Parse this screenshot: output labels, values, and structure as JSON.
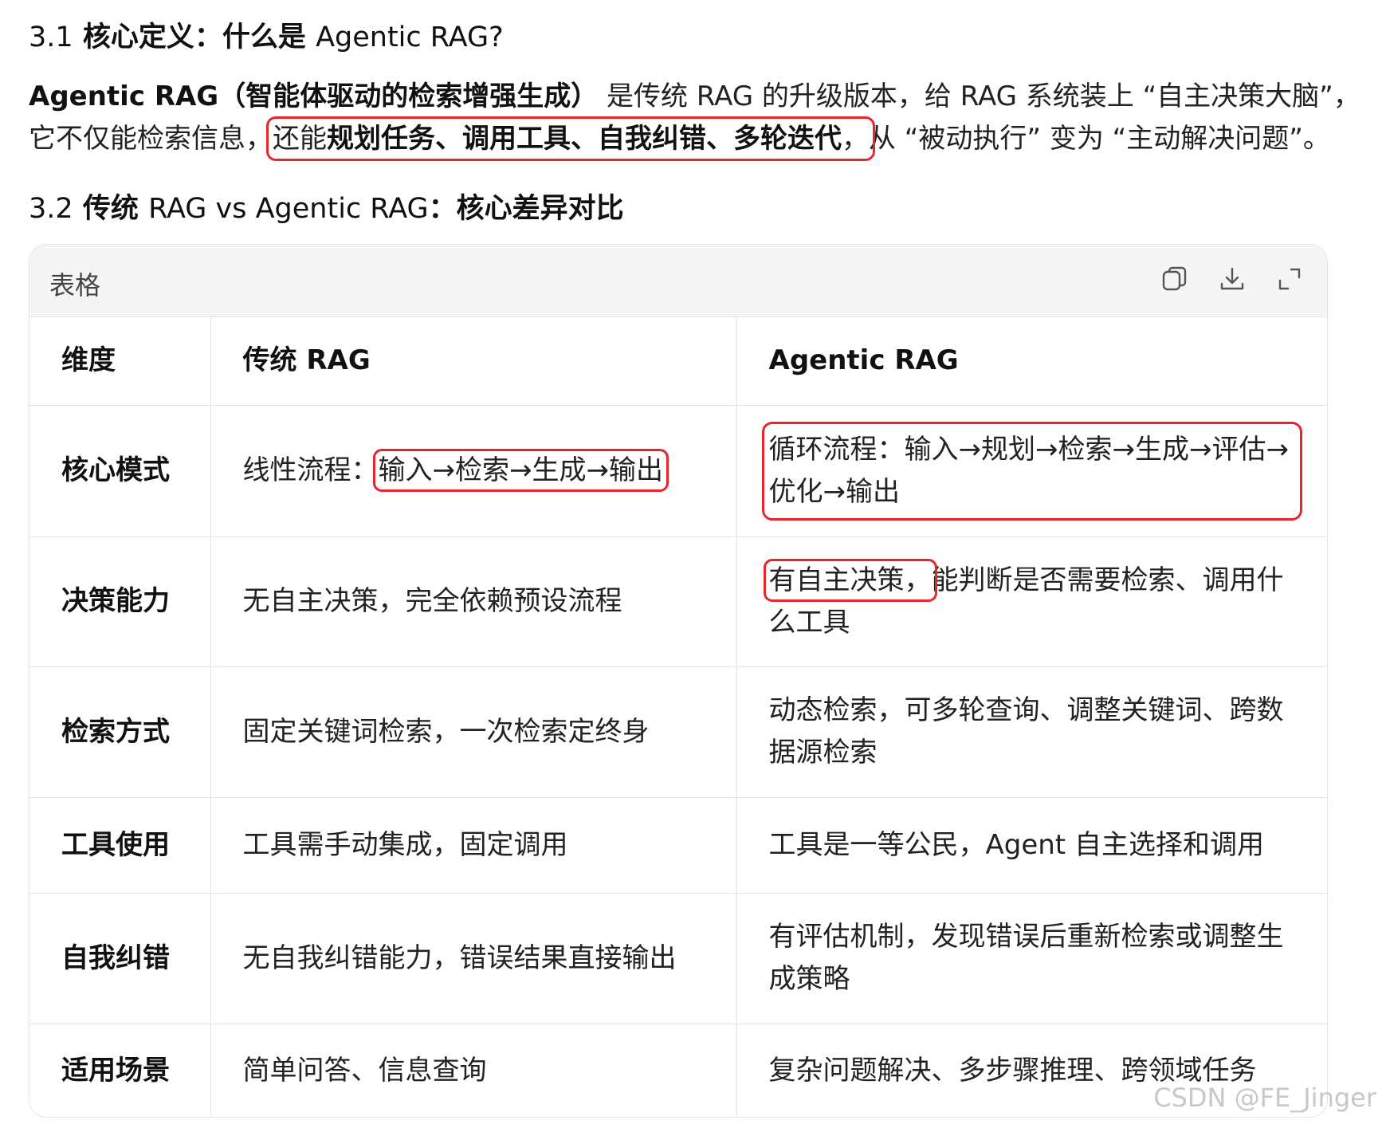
{
  "section1": {
    "number": "3.1",
    "title_cn": "核心定义：什么是",
    "title_en": "Agentic RAG?"
  },
  "paragraph": {
    "bold_term": "Agentic RAG（智能体驱动的检索增强生成）",
    "line1_rest": " 是传统 RAG 的升级版本，给 RAG 系统装上 “自主决策大脑”，",
    "line2_start": "它不仅能检索信息，",
    "highlight_plain": "还能",
    "highlight_bold": "规划任务、调用工具、自我纠错、多轮迭代",
    "highlight_comma": "，",
    "line2_end": "从 “被动执行” 变为 “主动解决问题”。"
  },
  "section2": {
    "number": "3.2",
    "title_cn_1": "传统",
    "title_en": "RAG vs Agentic RAG",
    "title_cn_2": "：核心差异对比"
  },
  "table_card": {
    "title": "表格",
    "icons": [
      "copy-icon",
      "download-icon",
      "expand-icon"
    ],
    "headers": [
      "维度",
      "传统 RAG",
      "Agentic RAG"
    ],
    "rows": [
      {
        "dim": "核心模式",
        "trad_prefix": "线性流程：",
        "trad_boxed": "输入→检索→生成→输出",
        "agentic_boxed": "循环流程：输入→规划→检索→生成→评估→优化→输出"
      },
      {
        "dim": "决策能力",
        "trad": "无自主决策，完全依赖预设流程",
        "agentic_boxed": "有自主决策，",
        "agentic_rest": "能判断是否需要检索、调用什么工具"
      },
      {
        "dim": "检索方式",
        "trad": "固定关键词检索，一次检索定终身",
        "agentic": "动态检索，可多轮查询、调整关键词、跨数据源检索"
      },
      {
        "dim": "工具使用",
        "trad": "工具需手动集成，固定调用",
        "agentic": "工具是一等公民，Agent 自主选择和调用"
      },
      {
        "dim": "自我纠错",
        "trad": "无自我纠错能力，错误结果直接输出",
        "agentic": "有评估机制，发现错误后重新检索或调整生成策略"
      },
      {
        "dim": "适用场景",
        "trad": "简单问答、信息查询",
        "agentic": "复杂问题解决、多步骤推理、跨领域任务"
      }
    ]
  },
  "watermark": "CSDN @FE_Jinger",
  "colors": {
    "highlight_border": "#e5262d",
    "header_bg": "#f5f5f5",
    "border": "#e3e3e3"
  }
}
